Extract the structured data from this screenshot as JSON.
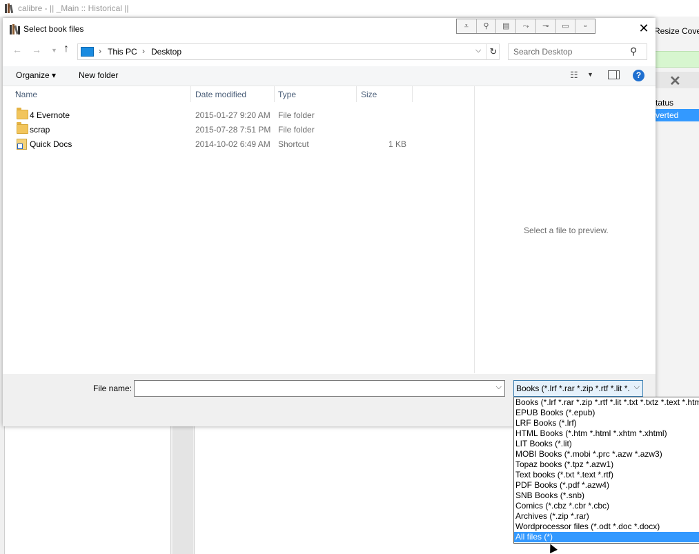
{
  "background_window": {
    "title": "calibre - || _Main :: Historical ||",
    "resize_label": "Resize Cove",
    "status_header": "tatus",
    "status_value": "verted"
  },
  "dialog": {
    "title": "Select book files",
    "breadcrumb": [
      "This PC",
      "Desktop"
    ],
    "search_placeholder": "Search Desktop",
    "organize_label": "Organize",
    "new_folder_label": "New folder",
    "columns": [
      "Name",
      "Date modified",
      "Type",
      "Size"
    ],
    "files": [
      {
        "name": "4 Evernote",
        "date": "2015-01-27 9:20 AM",
        "type": "File folder",
        "size": "",
        "icon": "folder-icon"
      },
      {
        "name": "scrap",
        "date": "2015-07-28 7:51 PM",
        "type": "File folder",
        "size": "",
        "icon": "folder-icon"
      },
      {
        "name": "Quick Docs",
        "date": "2014-10-02 6:49 AM",
        "type": "Shortcut",
        "size": "1 KB",
        "icon": "shortcut-icon"
      }
    ],
    "preview_text": "Select a file to preview.",
    "file_name_label": "File name:",
    "file_name_value": "",
    "file_type_selected": "Books (*.lrf *.rar *.zip *.rtf *.lit *.",
    "file_type_options": [
      "Books (*.lrf *.rar *.zip *.rtf *.lit *.txt *.txtz *.text *.htm",
      "EPUB Books (*.epub)",
      "LRF Books (*.lrf)",
      "HTML Books (*.htm *.html *.xhtm *.xhtml)",
      "LIT Books (*.lit)",
      "MOBI Books (*.mobi *.prc *.azw *.azw3)",
      "Topaz books (*.tpz *.azw1)",
      "Text books (*.txt *.text *.rtf)",
      "PDF Books (*.pdf *.azw4)",
      "SNB Books (*.snb)",
      "Comics (*.cbz *.cbr *.cbc)",
      "Archives (*.zip *.rar)",
      "Wordprocessor files (*.odt *.doc *.docx)",
      "All files  (*)"
    ],
    "highlighted_option_index": 13
  },
  "colors": {
    "selection": "#3399ff",
    "header_text": "#4c607a",
    "help_icon": "#1e6fd0"
  }
}
